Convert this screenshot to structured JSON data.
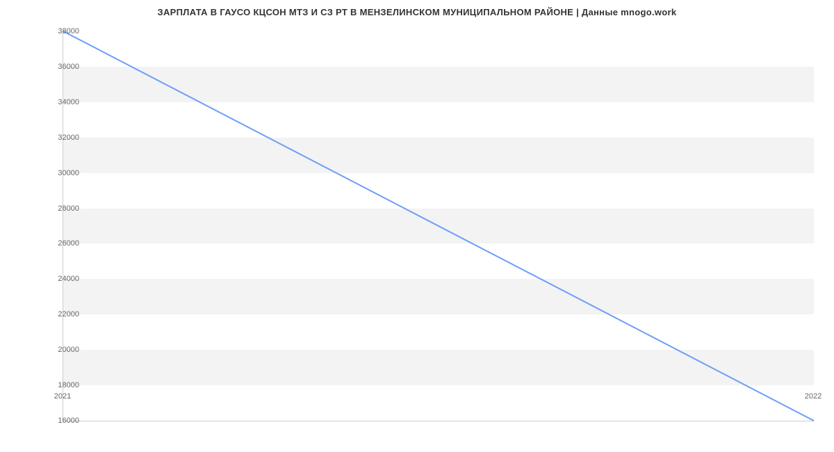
{
  "chart_data": {
    "type": "line",
    "title": "ЗАРПЛАТА В ГАУСО КЦСОН МТЗ И СЗ РТ В МЕНЗЕЛИНСКОМ МУНИЦИПАЛЬНОМ РАЙОНЕ | Данные mnogo.work",
    "x": [
      2021,
      2022
    ],
    "values": [
      38000,
      16000
    ],
    "xlabel": "",
    "ylabel": "",
    "xlim": [
      2021,
      2022
    ],
    "ylim": [
      16000,
      38000
    ],
    "y_ticks": [
      16000,
      18000,
      20000,
      22000,
      24000,
      26000,
      28000,
      30000,
      32000,
      34000,
      36000,
      38000
    ],
    "x_ticks": [
      2021,
      2022
    ],
    "line_color": "#6c9ef8"
  }
}
